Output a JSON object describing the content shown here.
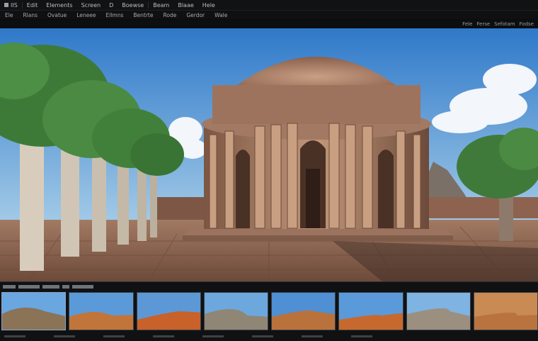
{
  "menubar": {
    "items": [
      {
        "label": "IIS"
      },
      {
        "label": "Edit"
      },
      {
        "label": "Elements"
      },
      {
        "label": "Screen"
      },
      {
        "label": "D"
      },
      {
        "label": "Boewse"
      },
      {
        "label": "Beam"
      },
      {
        "label": "Blaae"
      },
      {
        "label": "Hele"
      }
    ]
  },
  "toolbar": {
    "items": [
      {
        "label": "Ele"
      },
      {
        "label": "Rlans"
      },
      {
        "label": "Ovatue"
      },
      {
        "label": "Leneee"
      },
      {
        "label": "Ellmns"
      },
      {
        "label": "Bentrte"
      },
      {
        "label": "Rode"
      },
      {
        "label": "Gerdor"
      },
      {
        "label": "Wale"
      }
    ]
  },
  "subbar": {
    "items": [
      {
        "label": "Fele"
      },
      {
        "label": "Ferse"
      },
      {
        "label": "Sefotam"
      },
      {
        "label": "Fodse"
      }
    ]
  },
  "filmstrip": {
    "thumbnails": [
      {
        "label": "canyon-wall",
        "sky": "#6aa6df",
        "ground": "#8a7356"
      },
      {
        "label": "dune-ridge",
        "sky": "#5b9ad9",
        "ground": "#c2753a"
      },
      {
        "label": "orange-dunes",
        "sky": "#5c98d6",
        "ground": "#c8612a"
      },
      {
        "label": "rock-slope",
        "sky": "#6ca8dd",
        "ground": "#8f8676"
      },
      {
        "label": "desert-valley",
        "sky": "#4f8fd4",
        "ground": "#b9723c"
      },
      {
        "label": "sand-cliffs",
        "sky": "#5a9adb",
        "ground": "#c7692e"
      },
      {
        "label": "rock-outcrop",
        "sky": "#7fb3e2",
        "ground": "#9b8f80"
      },
      {
        "label": "sand-closeup",
        "sky": "#c98a54",
        "ground": "#b9733f"
      }
    ]
  },
  "colors": {
    "sky_top": "#2f79c9",
    "sky_bottom": "#a9cfe9",
    "stone": "#b6876a",
    "ground": "#9c6f57",
    "foliage": "#3f7a3a"
  }
}
